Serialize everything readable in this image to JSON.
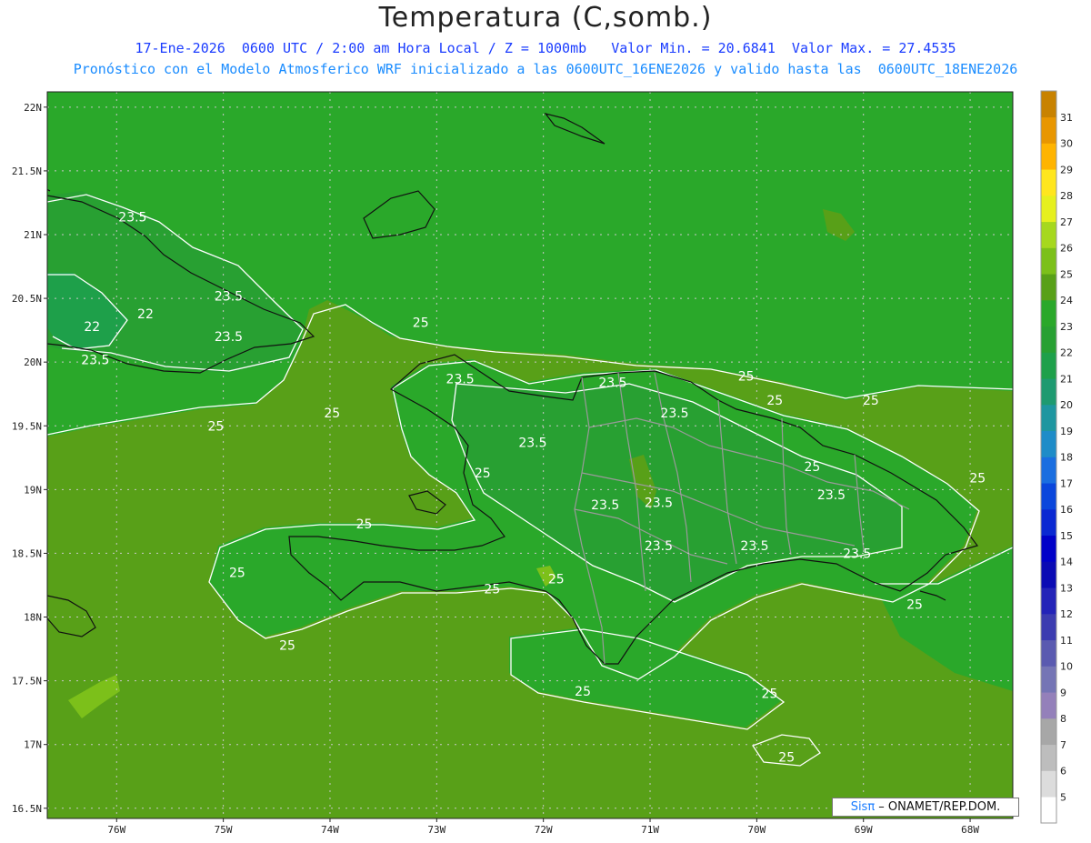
{
  "header": {
    "title": "Temperatura (C,somb.)",
    "line1": "17-Ene-2026  0600 UTC / 2:00 am Hora Local / Z = 1000mb   Valor Min. = 20.6841  Valor Max. = 27.4535",
    "line2": "Pronóstico con el Modelo Atmosferico WRF inicializado a las 0600UTC_16ENE2026 y valido hasta las  0600UTC_18ENE2026"
  },
  "axes": {
    "lat_labels": [
      "22N",
      "21.5N",
      "21N",
      "20.5N",
      "20N",
      "19.5N",
      "19N",
      "18.5N",
      "18N",
      "17.5N",
      "17N",
      "16.5N"
    ],
    "lat_values": [
      22,
      21.5,
      21,
      20.5,
      20,
      19.5,
      19,
      18.5,
      18,
      17.5,
      17,
      16.5
    ],
    "lon_labels": [
      "76W",
      "75W",
      "74W",
      "73W",
      "72W",
      "71W",
      "70W",
      "69W",
      "68W"
    ],
    "lon_values": [
      -76,
      -75,
      -74,
      -73,
      -72,
      -71,
      -70,
      -69,
      -68
    ],
    "lat_range": [
      16.42,
      22.12
    ],
    "lon_range": [
      -76.65,
      -67.6
    ]
  },
  "colorbar": {
    "levels": [
      "5",
      "6",
      "7",
      "8",
      "9",
      "10",
      "11",
      "12",
      "13",
      "14",
      "15",
      "16",
      "17",
      "18",
      "19",
      "20",
      "21",
      "22",
      "23",
      "24",
      "25",
      "26",
      "27",
      "28",
      "29",
      "30",
      "31"
    ],
    "colors": [
      "#ffffff",
      "#dcdcdc",
      "#bdbdbd",
      "#a7a7a7",
      "#9480ba",
      "#7575b5",
      "#5a5ab0",
      "#3c3cb0",
      "#2323b8",
      "#0a0ab4",
      "#0000c8",
      "#0a28d2",
      "#0a46dc",
      "#1a6ee0",
      "#1e8cc8",
      "#1e96a0",
      "#1e9a70",
      "#1ea04a",
      "#28a032",
      "#2aa82a",
      "#58a018",
      "#7cc01a",
      "#a6d81e",
      "#e6f01e",
      "#ffe61e",
      "#ffb400",
      "#e89600",
      "#c88200"
    ]
  },
  "contour_labels": [
    {
      "text": "23.5",
      "lon": -75.85,
      "lat": 21.14
    },
    {
      "text": "23.5",
      "lon": -74.95,
      "lat": 20.52
    },
    {
      "text": "22",
      "lon": -75.73,
      "lat": 20.38
    },
    {
      "text": "22",
      "lon": -76.23,
      "lat": 20.28
    },
    {
      "text": "23.5",
      "lon": -74.95,
      "lat": 20.2
    },
    {
      "text": "23.5",
      "lon": -76.2,
      "lat": 20.02
    },
    {
      "text": "25",
      "lon": -73.15,
      "lat": 20.31
    },
    {
      "text": "25",
      "lon": -73.98,
      "lat": 19.6
    },
    {
      "text": "25",
      "lon": -75.07,
      "lat": 19.5
    },
    {
      "text": "23.5",
      "lon": -72.78,
      "lat": 19.87
    },
    {
      "text": "23.5",
      "lon": -71.35,
      "lat": 19.84
    },
    {
      "text": "25",
      "lon": -70.1,
      "lat": 19.89
    },
    {
      "text": "25",
      "lon": -69.83,
      "lat": 19.7
    },
    {
      "text": "25",
      "lon": -68.93,
      "lat": 19.7
    },
    {
      "text": "23.5",
      "lon": -70.77,
      "lat": 19.6
    },
    {
      "text": "23.5",
      "lon": -72.1,
      "lat": 19.37
    },
    {
      "text": "25",
      "lon": -72.57,
      "lat": 19.13
    },
    {
      "text": "25",
      "lon": -69.48,
      "lat": 19.18
    },
    {
      "text": "25",
      "lon": -67.93,
      "lat": 19.09
    },
    {
      "text": "23.5",
      "lon": -71.42,
      "lat": 18.88
    },
    {
      "text": "23.5",
      "lon": -70.92,
      "lat": 18.9
    },
    {
      "text": "23.5",
      "lon": -69.3,
      "lat": 18.96
    },
    {
      "text": "25",
      "lon": -73.68,
      "lat": 18.73
    },
    {
      "text": "23.5",
      "lon": -70.92,
      "lat": 18.56
    },
    {
      "text": "23.5",
      "lon": -70.02,
      "lat": 18.56
    },
    {
      "text": "23.5",
      "lon": -69.06,
      "lat": 18.5
    },
    {
      "text": "25",
      "lon": -74.87,
      "lat": 18.35
    },
    {
      "text": "25",
      "lon": -72.48,
      "lat": 18.22
    },
    {
      "text": "25",
      "lon": -71.88,
      "lat": 18.3
    },
    {
      "text": "25",
      "lon": -68.52,
      "lat": 18.1
    },
    {
      "text": "25",
      "lon": -74.4,
      "lat": 17.78
    },
    {
      "text": "25",
      "lon": -71.63,
      "lat": 17.42
    },
    {
      "text": "25",
      "lon": -69.88,
      "lat": 17.4
    },
    {
      "text": "25",
      "lon": -69.72,
      "lat": 16.9
    }
  ],
  "credit": {
    "brand": "Sisπ",
    "text": " – ONAMET/REP.DOM."
  }
}
